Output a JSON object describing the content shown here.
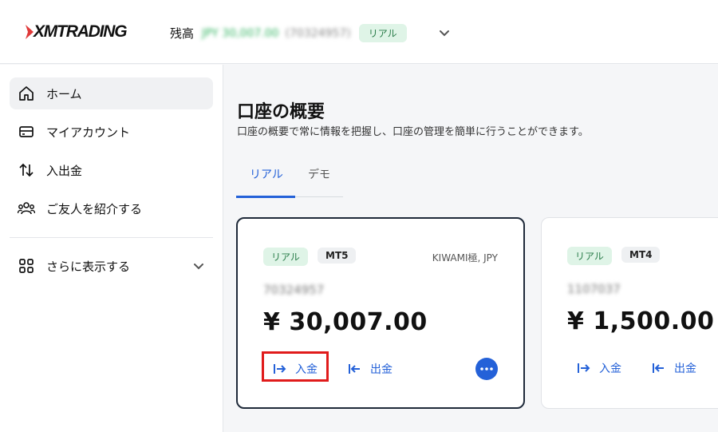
{
  "header": {
    "logo_text": "XMTRADING",
    "balance_label": "残高",
    "balance_amount": "JPY 30,007.00",
    "balance_account": "(70324957)",
    "account_type": "リアル"
  },
  "sidebar": {
    "items": [
      {
        "label": "ホーム",
        "icon": "home-icon"
      },
      {
        "label": "マイアカウント",
        "icon": "wallet-icon"
      },
      {
        "label": "入出金",
        "icon": "transfer-arrows-icon"
      },
      {
        "label": "ご友人を紹介する",
        "icon": "users-icon"
      }
    ],
    "more_label": "さらに表示する"
  },
  "main": {
    "title": "口座の概要",
    "subtitle": "口座の概要で常に情報を把握し、口座の管理を簡単に行うことができます。",
    "tabs": [
      {
        "label": "リアル",
        "active": true
      },
      {
        "label": "デモ",
        "active": false
      }
    ],
    "accounts": [
      {
        "type_badge": "リアル",
        "platform": "MT5",
        "account_kind": "KIWAMI極, JPY",
        "account_number": "70324957",
        "balance": "¥ 30,007.00",
        "deposit_label": "入金",
        "withdraw_label": "出金"
      },
      {
        "type_badge": "リアル",
        "platform": "MT4",
        "account_kind": "",
        "account_number": "1107037",
        "balance": "¥ 1,500.00",
        "deposit_label": "入金",
        "withdraw_label": "出金"
      }
    ]
  },
  "colors": {
    "accent": "#2461d8",
    "highlight": "#e01b1b",
    "real_badge_bg": "#dff4e7",
    "logo_mark": "#e03a3a"
  }
}
